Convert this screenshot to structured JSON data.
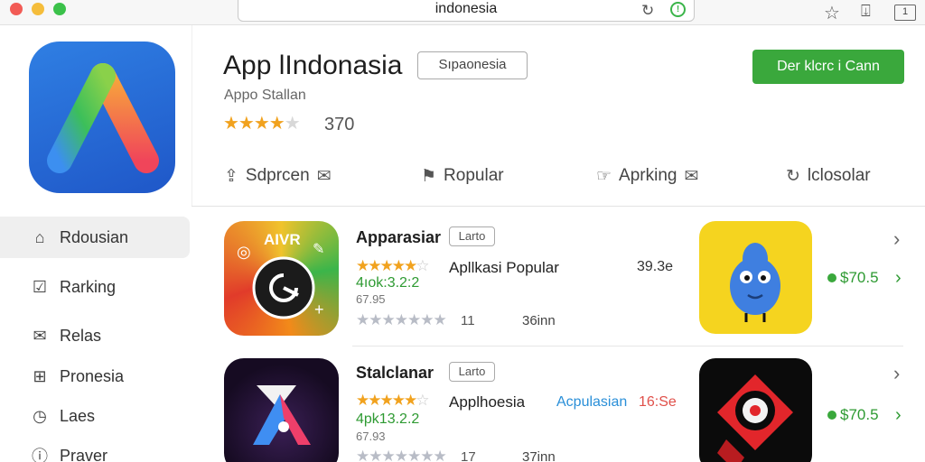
{
  "browser": {
    "address": "indonesia",
    "tabs_count": "1"
  },
  "app": {
    "title": "App lIndonasia",
    "language_button": "Sıpaonesia",
    "download_button": "Der klcrc i Cann",
    "developer": "Appo Stallan",
    "rating_count": "370",
    "rating": 4
  },
  "tabs": [
    {
      "label": "Sdprcen"
    },
    {
      "label": "Ropular"
    },
    {
      "label": "Aprking"
    },
    {
      "label": "lclosolar"
    }
  ],
  "sidebar": {
    "items": [
      {
        "label": "Rdousian",
        "icon": "home-icon"
      },
      {
        "label": "Rarking",
        "icon": "edit-icon"
      },
      {
        "label": "Relas",
        "icon": "mail-icon"
      },
      {
        "label": "Pronesia",
        "icon": "grid-icon"
      },
      {
        "label": "Laes",
        "icon": "clock-icon"
      },
      {
        "label": "Praver",
        "icon": "info-icon"
      }
    ]
  },
  "rows": [
    {
      "title": "Apparasiar",
      "badge": "Larto",
      "icon_text": "AIVR",
      "subtitle": "Apllkasi Popular",
      "green_text": "4ıok:3.2:2",
      "small_text": "67.95",
      "grey_count": "11",
      "size": "36inn",
      "number": "39.3e",
      "price": "$70.5",
      "rating": 4.5
    },
    {
      "title": "Stalclanar",
      "badge": "Larto",
      "subtitle": "Applhoesia",
      "green_text": "4pk13.2.2",
      "small_text": "67.93",
      "grey_count": "17",
      "size": "37inn",
      "blue_text": "Acpulasian",
      "red_text": "16:Se",
      "price": "$70.5",
      "rating": 4.5
    }
  ],
  "colors": {
    "accent_green": "#3aa83c",
    "star_gold": "#f1a21e",
    "app_icon_blue": "#2f7fe3"
  }
}
